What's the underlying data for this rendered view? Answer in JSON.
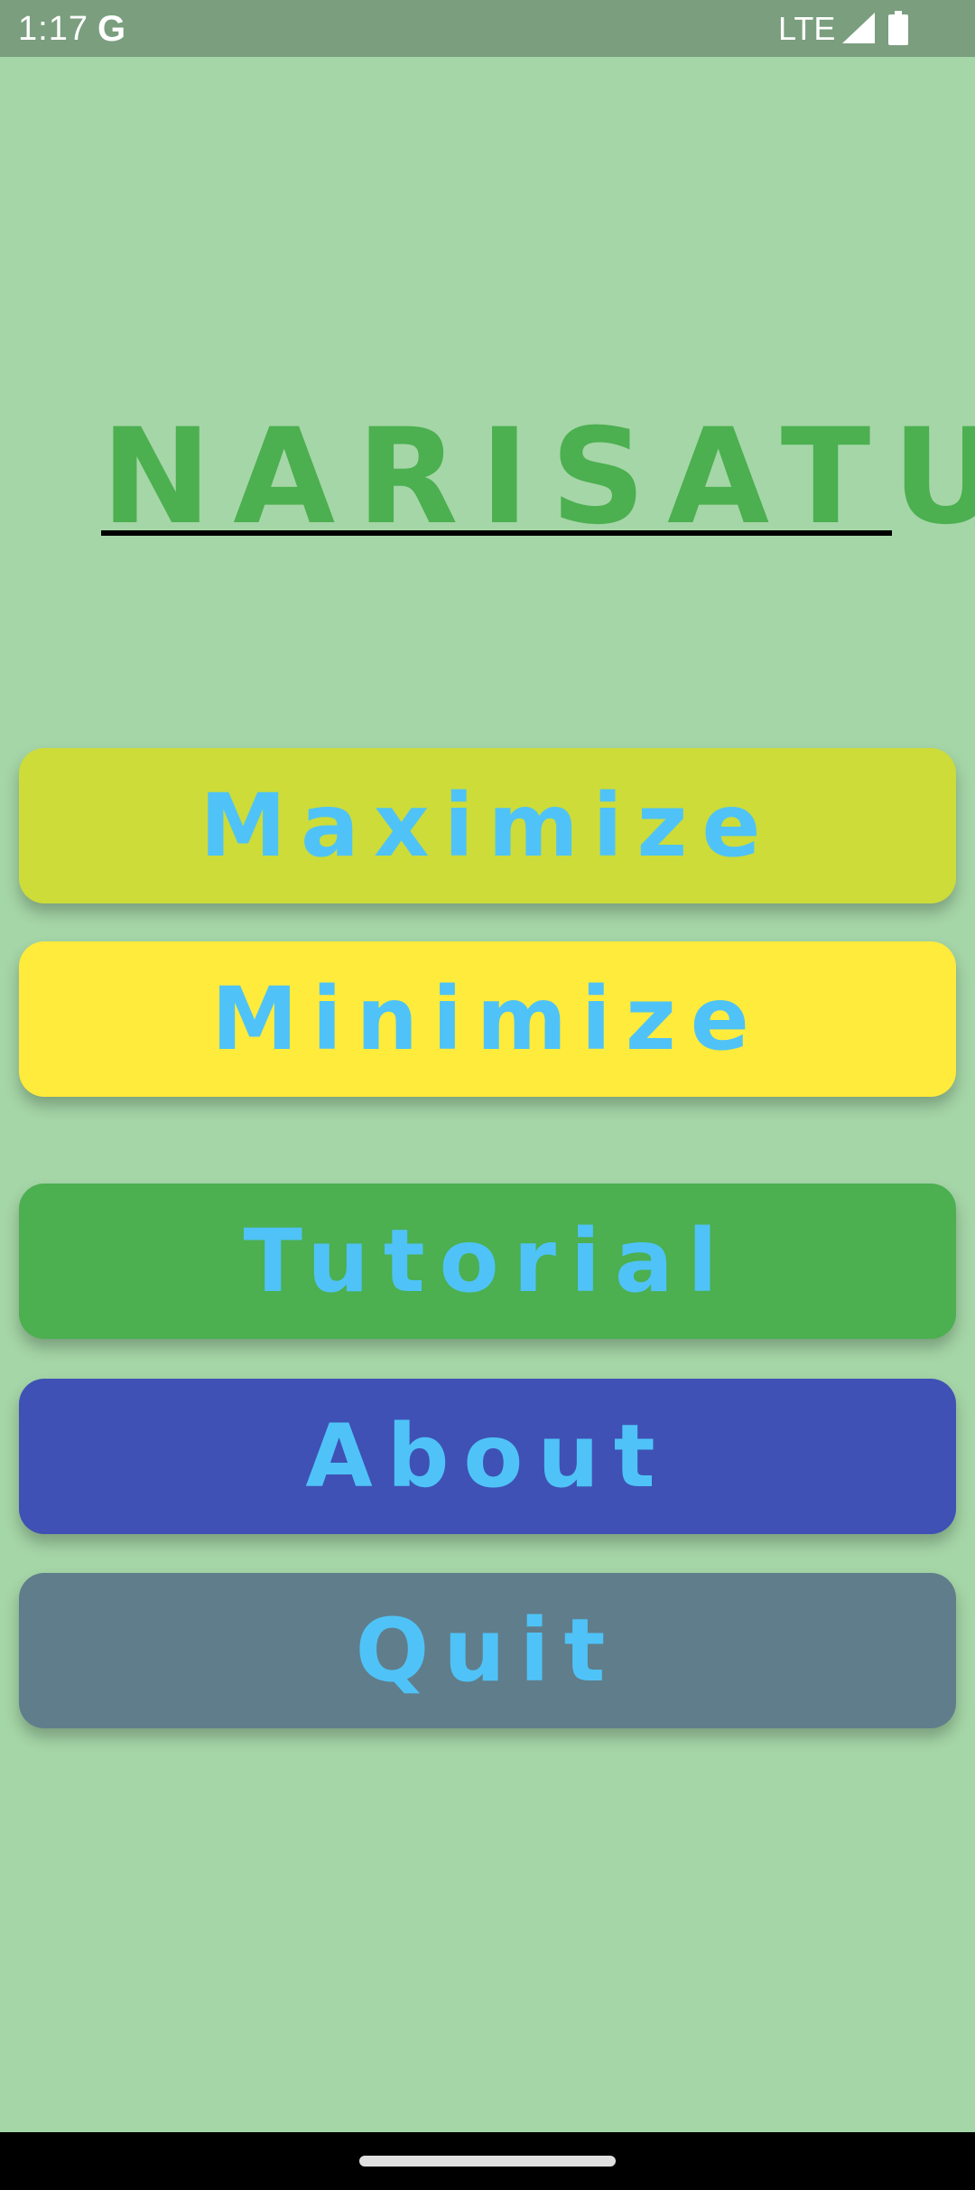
{
  "status_bar": {
    "time": "1:17",
    "g_label": "G",
    "network": "LTE",
    "icons": [
      "google-icon",
      "signal-icon",
      "battery-icon"
    ]
  },
  "app": {
    "title": "NARISATU"
  },
  "menu": {
    "buttons": [
      {
        "label": "Maximize",
        "color": "#cddc39"
      },
      {
        "label": "Minimize",
        "color": "#ffeb3b"
      },
      {
        "label": "Tutorial",
        "color": "#4caf50"
      },
      {
        "label": "About",
        "color": "#3f51b5"
      },
      {
        "label": "Quit",
        "color": "#607d8b"
      }
    ],
    "text_color": "#4fc3f7"
  },
  "colors": {
    "background": "#a5d6a7",
    "title": "#4caf50",
    "status_bar": "#7a9e7e"
  }
}
